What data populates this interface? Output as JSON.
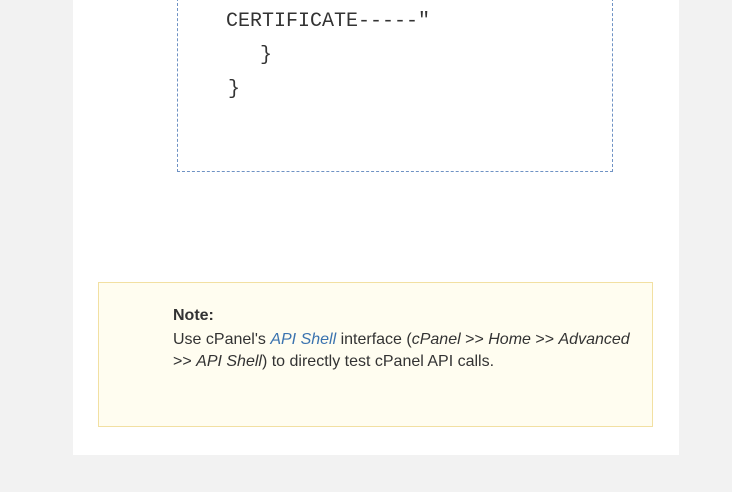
{
  "code": {
    "line1": "CERTIFICATE-----\"",
    "line2": "}",
    "line3": "}"
  },
  "note": {
    "title": "Note:",
    "text_1": "Use cPanel's ",
    "link_label": "API Shell",
    "text_2": " interface (",
    "path_1": "cPanel",
    "sep_1": " >> ",
    "path_2": "Home",
    "sep_2": " >> ",
    "path_3": "Advanced",
    "sep_3": " >> ",
    "path_4": "API Shell",
    "text_3": ") to directly test cPanel API calls."
  },
  "colors": {
    "page_background": "#f2f2f2",
    "content_background": "#ffffff",
    "code_border": "#6f92c4",
    "note_background": "#fffdf0",
    "note_border": "#f2e0a2",
    "link": "#3b73af"
  }
}
